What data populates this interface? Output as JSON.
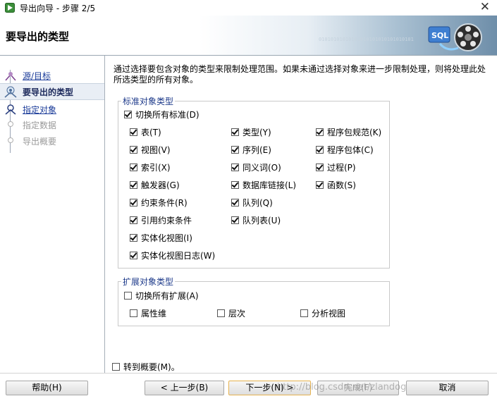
{
  "window": {
    "title": "导出向导 - 步骤 2/5"
  },
  "header": {
    "title": "要导出的类型",
    "binary_text": "01010101010101010101010101010101"
  },
  "steps": [
    {
      "label": "源/目标",
      "state": "link"
    },
    {
      "label": "要导出的类型",
      "state": "current"
    },
    {
      "label": "指定对象",
      "state": "link"
    },
    {
      "label": "指定数据",
      "state": "disabled"
    },
    {
      "label": "导出概要",
      "state": "disabled"
    }
  ],
  "description": "通过选择要包含对象的类型来限制处理范围。如果未通过选择对象来进一步限制处理，则将处理此处所选类型的所有对象。",
  "standard_group": {
    "legend": "标准对象类型",
    "toggle_all": {
      "label": "切换所有标准(D)",
      "checked": true
    },
    "items": [
      {
        "label": "表(T)",
        "checked": true
      },
      {
        "label": "类型(Y)",
        "checked": true
      },
      {
        "label": "程序包规范(K)",
        "checked": true
      },
      {
        "label": "视图(V)",
        "checked": true
      },
      {
        "label": "序列(E)",
        "checked": true
      },
      {
        "label": "程序包体(C)",
        "checked": true
      },
      {
        "label": "索引(X)",
        "checked": true
      },
      {
        "label": "同义词(O)",
        "checked": true
      },
      {
        "label": "过程(P)",
        "checked": true
      },
      {
        "label": "触发器(G)",
        "checked": true
      },
      {
        "label": "数据库链接(L)",
        "checked": true
      },
      {
        "label": "函数(S)",
        "checked": true
      },
      {
        "label": "约束条件(R)",
        "checked": true
      },
      {
        "label": "队列(Q)",
        "checked": true
      },
      {
        "label": "引用约束条件",
        "checked": true
      },
      {
        "label": "队列表(U)",
        "checked": true
      },
      {
        "label": "实体化视图(I)",
        "checked": true
      },
      {
        "label": "实体化视图日志(W)",
        "checked": true
      }
    ]
  },
  "extended_group": {
    "legend": "扩展对象类型",
    "toggle_all": {
      "label": "切换所有扩展(A)",
      "checked": false
    },
    "items": [
      {
        "label": "属性维",
        "checked": false
      },
      {
        "label": "层次",
        "checked": false
      },
      {
        "label": "分析视图",
        "checked": false
      }
    ]
  },
  "goto_summary": {
    "label": "转到概要(M)。",
    "checked": false
  },
  "buttons": {
    "help": "帮助(H)",
    "back": "< 上一步(B)",
    "next": "下一步(N) >",
    "finish": "完成(F)",
    "cancel": "取消"
  },
  "watermark": "http://blog.csdn.net/zlandog",
  "colors": {
    "accent_link": "#1a3b99",
    "focus_border": "#e6b24f",
    "group_legend": "#1d3a8a"
  }
}
